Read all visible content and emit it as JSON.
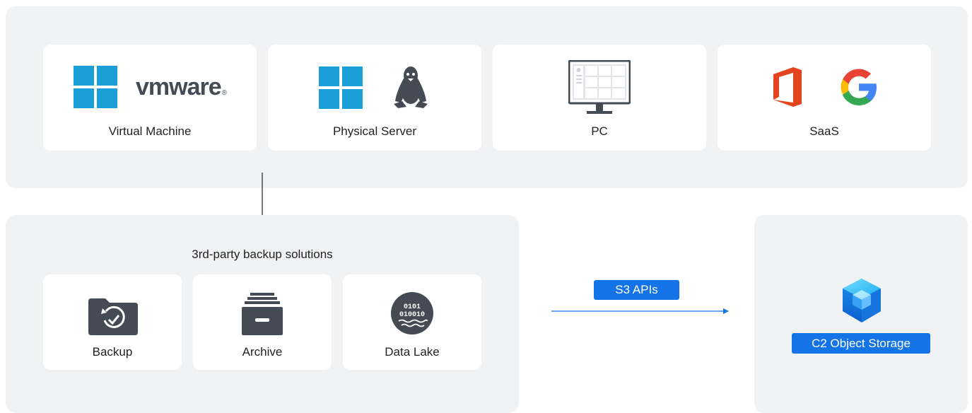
{
  "sources": {
    "cards": [
      {
        "label": "Virtual Machine",
        "icons": [
          "windows-logo",
          "vmware-logo"
        ],
        "logo_text": "vmware"
      },
      {
        "label": "Physical Server",
        "icons": [
          "windows-logo",
          "linux-tux-logo"
        ]
      },
      {
        "label": "PC",
        "icons": [
          "monitor-icon"
        ]
      },
      {
        "label": "SaaS",
        "icons": [
          "office-logo",
          "google-logo"
        ]
      }
    ]
  },
  "backup_solutions": {
    "title": "3rd-party backup solutions",
    "cards": [
      {
        "label": "Backup",
        "icon": "folder-restore-icon"
      },
      {
        "label": "Archive",
        "icon": "archive-cabinet-icon"
      },
      {
        "label": "Data Lake",
        "icon": "data-lake-icon"
      }
    ]
  },
  "connection": {
    "label": "S3 APIs"
  },
  "storage": {
    "label": "C2 Object Storage",
    "icon": "cube-icon"
  },
  "colors": {
    "panel": "#f1f2f4",
    "accent_blue": "#1473e6",
    "windows_blue": "#1a9fd9",
    "icon_gray": "#454b54",
    "office_orange": "#e3441d"
  }
}
